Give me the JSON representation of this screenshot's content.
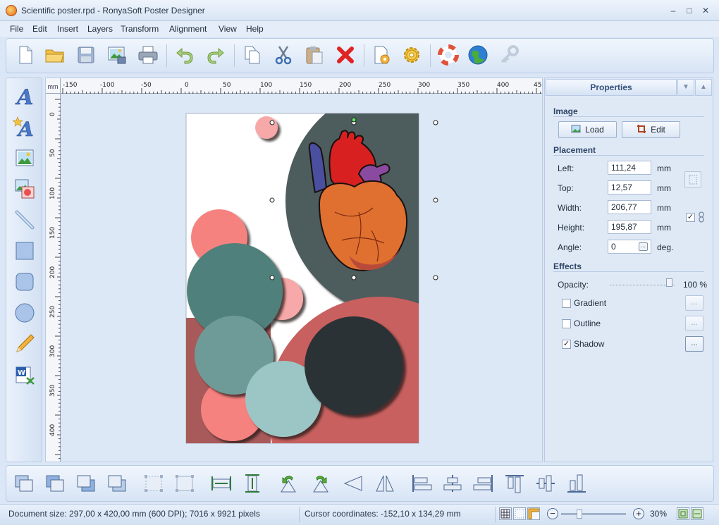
{
  "window": {
    "title": "Scientific poster.rpd - RonyaSoft Poster Designer",
    "minimize": "–",
    "maximize": "□",
    "close": "✕"
  },
  "menu": [
    "File",
    "Edit",
    "Insert",
    "Layers",
    "Transform",
    "Alignment",
    "View",
    "Help"
  ],
  "toolbar": {
    "icons": [
      "new-file-icon",
      "open-folder-icon",
      "save-icon",
      "export-image-icon",
      "print-icon",
      "undo-icon",
      "redo-icon",
      "copy-icon",
      "cut-icon",
      "paste-icon",
      "delete-icon",
      "page-settings-icon",
      "options-gear-icon",
      "help-lifebuoy-icon",
      "web-globe-icon",
      "register-key-icon"
    ]
  },
  "left_tools": [
    "text-icon",
    "art-text-icon",
    "image-icon",
    "clipart-icon",
    "line-icon",
    "rectangle-icon",
    "rounded-rectangle-icon",
    "ellipse-icon",
    "pencil-icon",
    "word-document-icon"
  ],
  "ruler": {
    "unit": "mm",
    "h_labels": [
      "-150",
      "-100",
      "-50",
      "0",
      "50",
      "100",
      "150",
      "200",
      "250",
      "300",
      "350",
      "400",
      "45"
    ],
    "v_labels": [
      "0",
      "50",
      "100",
      "150",
      "200",
      "250",
      "300",
      "350",
      "400"
    ]
  },
  "properties": {
    "header": "Properties",
    "image_section": "Image",
    "load_label": "Load",
    "edit_label": "Edit",
    "placement_section": "Placement",
    "fields": [
      {
        "label": "Left:",
        "value": "111,24",
        "unit": "mm"
      },
      {
        "label": "Top:",
        "value": "12,57",
        "unit": "mm"
      },
      {
        "label": "Width:",
        "value": "206,77",
        "unit": "mm"
      },
      {
        "label": "Height:",
        "value": "195,87",
        "unit": "mm"
      },
      {
        "label": "Angle:",
        "value": "0",
        "unit": "deg."
      }
    ],
    "effects_section": "Effects",
    "opacity_label": "Opacity:",
    "opacity_value": "100 %",
    "opacity_level": 1.0,
    "gradient_label": "Gradient",
    "gradient_checked": false,
    "outline_label": "Outline",
    "outline_checked": false,
    "shadow_label": "Shadow",
    "shadow_checked": true,
    "lock_ratio_checked": true,
    "dots": "..."
  },
  "bottom_toolbar": {
    "icons": [
      "bring-to-front-icon",
      "bring-forward-icon",
      "send-backward-icon",
      "send-to-back-icon",
      "group-icon",
      "ungroup-icon",
      "fit-width-icon",
      "fit-height-icon",
      "rotate-left-icon",
      "rotate-right-icon",
      "flip-horizontal-icon",
      "flip-vertical-icon",
      "align-left-icon",
      "align-center-icon",
      "align-right-icon",
      "align-top-icon",
      "align-middle-icon",
      "align-bottom-icon"
    ]
  },
  "status": {
    "document_size": "Document size: 297,00 x 420,00 mm (600 DPI); 7016 x 9921 pixels",
    "cursor": "Cursor coordinates: -152,10 x 134,29 mm",
    "zoom": "30%"
  },
  "colors": {
    "accent": "#34507a",
    "poster_white": "#ffffff",
    "dark_gray": "#4e5c5c",
    "coral": "#f5827f",
    "teal": "#4f807c",
    "pale_teal": "#9cc6c6",
    "charcoal": "#2c3335",
    "maroon_red": "#c7605f",
    "pink": "#f7a8a8",
    "heart_red": "#d92020",
    "heart_orange": "#e07030",
    "heart_blue": "#4a4fa0",
    "heart_purple": "#8a4aa0"
  }
}
